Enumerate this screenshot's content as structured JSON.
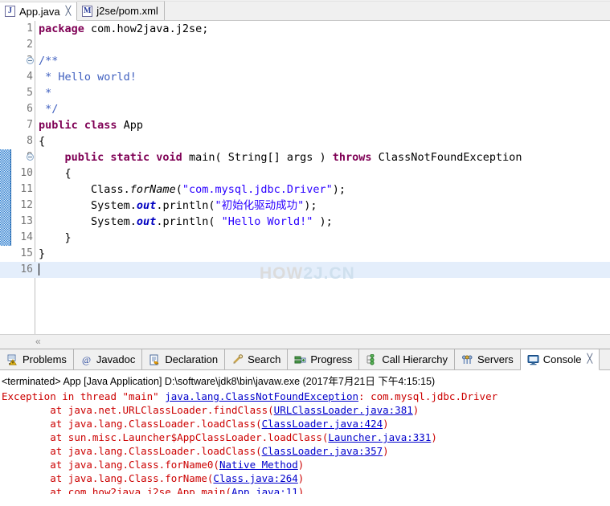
{
  "editor_tabs": [
    {
      "label": "App.java",
      "icon": "java-file-icon",
      "icon_letter": "J",
      "active": true,
      "closable": true
    },
    {
      "label": "j2se/pom.xml",
      "icon": "maven-file-icon",
      "icon_letter": "M",
      "active": false,
      "closable": false
    }
  ],
  "close_glyph": "╳",
  "editor": {
    "scroll_chevron": "«",
    "watermark_part1": "HOW",
    "watermark_part2": "2J.CN",
    "marker_start_line": 9,
    "marker_end_line": 14,
    "highlighted_line": 16,
    "lines": [
      {
        "n": "1",
        "fold": false,
        "segments": [
          {
            "t": "package ",
            "c": "kw"
          },
          {
            "t": "com.how2java.j2se;",
            "c": "plain"
          }
        ]
      },
      {
        "n": "2",
        "fold": false,
        "segments": []
      },
      {
        "n": "3",
        "fold": true,
        "segments": [
          {
            "t": "/**",
            "c": "cmt"
          }
        ]
      },
      {
        "n": "4",
        "fold": false,
        "segments": [
          {
            "t": " * Hello world!",
            "c": "cmt"
          }
        ]
      },
      {
        "n": "5",
        "fold": false,
        "segments": [
          {
            "t": " *",
            "c": "cmt"
          }
        ]
      },
      {
        "n": "6",
        "fold": false,
        "segments": [
          {
            "t": " */",
            "c": "cmt"
          }
        ]
      },
      {
        "n": "7",
        "fold": false,
        "segments": [
          {
            "t": "public class ",
            "c": "kw"
          },
          {
            "t": "App",
            "c": "plain"
          }
        ]
      },
      {
        "n": "8",
        "fold": false,
        "segments": [
          {
            "t": "{",
            "c": "plain"
          }
        ]
      },
      {
        "n": "9",
        "fold": true,
        "segments": [
          {
            "t": "    ",
            "c": "plain"
          },
          {
            "t": "public static void ",
            "c": "kw"
          },
          {
            "t": "main( String[] args ) ",
            "c": "plain"
          },
          {
            "t": "throws ",
            "c": "kw"
          },
          {
            "t": "ClassNotFoundException",
            "c": "plain"
          }
        ]
      },
      {
        "n": "10",
        "fold": false,
        "segments": [
          {
            "t": "    {",
            "c": "plain"
          }
        ]
      },
      {
        "n": "11",
        "fold": false,
        "segments": [
          {
            "t": "        Class.",
            "c": "plain"
          },
          {
            "t": "forName",
            "c": "stat"
          },
          {
            "t": "(",
            "c": "plain"
          },
          {
            "t": "\"com.mysql.jdbc.Driver\"",
            "c": "str"
          },
          {
            "t": ");",
            "c": "plain"
          }
        ]
      },
      {
        "n": "12",
        "fold": false,
        "segments": [
          {
            "t": "        System.",
            "c": "plain"
          },
          {
            "t": "out",
            "c": "fld"
          },
          {
            "t": ".println(",
            "c": "plain"
          },
          {
            "t": "\"初始化驱动成功\"",
            "c": "str"
          },
          {
            "t": ");",
            "c": "plain"
          }
        ]
      },
      {
        "n": "13",
        "fold": false,
        "segments": [
          {
            "t": "        System.",
            "c": "plain"
          },
          {
            "t": "out",
            "c": "fld"
          },
          {
            "t": ".println( ",
            "c": "plain"
          },
          {
            "t": "\"Hello World!\"",
            "c": "str"
          },
          {
            "t": " );",
            "c": "plain"
          }
        ]
      },
      {
        "n": "14",
        "fold": false,
        "segments": [
          {
            "t": "    }",
            "c": "plain"
          }
        ]
      },
      {
        "n": "15",
        "fold": false,
        "segments": [
          {
            "t": "}",
            "c": "plain"
          }
        ]
      },
      {
        "n": "16",
        "fold": false,
        "caret": true,
        "segments": []
      }
    ]
  },
  "view_tabs": [
    {
      "label": "Problems",
      "icon": "problems-icon",
      "active": false,
      "closable": false
    },
    {
      "label": "Javadoc",
      "icon": "javadoc-icon",
      "active": false,
      "closable": false
    },
    {
      "label": "Declaration",
      "icon": "declaration-icon",
      "active": false,
      "closable": false
    },
    {
      "label": "Search",
      "icon": "search-icon",
      "active": false,
      "closable": false
    },
    {
      "label": "Progress",
      "icon": "progress-icon",
      "active": false,
      "closable": false
    },
    {
      "label": "Call Hierarchy",
      "icon": "call-hierarchy-icon",
      "active": false,
      "closable": false
    },
    {
      "label": "Servers",
      "icon": "servers-icon",
      "active": false,
      "closable": false
    },
    {
      "label": "Console",
      "icon": "console-icon",
      "active": true,
      "closable": true
    }
  ],
  "console": {
    "header": "<terminated> App [Java Application] D:\\software\\jdk8\\bin\\javaw.exe (2017年7月21日 下午4:15:15)",
    "lines": [
      {
        "parts": [
          {
            "t": "Exception in thread ",
            "link": false
          },
          {
            "t": "\"main\" ",
            "link": false
          },
          {
            "t": "java.lang.ClassNotFoundException",
            "link": true
          },
          {
            "t": ": com.mysql.jdbc.Driver",
            "link": false
          }
        ]
      },
      {
        "parts": [
          {
            "t": "\tat java.net.URLClassLoader.findClass(",
            "link": false
          },
          {
            "t": "URLClassLoader.java:381",
            "link": true
          },
          {
            "t": ")",
            "link": false
          }
        ]
      },
      {
        "parts": [
          {
            "t": "\tat java.lang.ClassLoader.loadClass(",
            "link": false
          },
          {
            "t": "ClassLoader.java:424",
            "link": true
          },
          {
            "t": ")",
            "link": false
          }
        ]
      },
      {
        "parts": [
          {
            "t": "\tat sun.misc.Launcher$AppClassLoader.loadClass(",
            "link": false
          },
          {
            "t": "Launcher.java:331",
            "link": true
          },
          {
            "t": ")",
            "link": false
          }
        ]
      },
      {
        "parts": [
          {
            "t": "\tat java.lang.ClassLoader.loadClass(",
            "link": false
          },
          {
            "t": "ClassLoader.java:357",
            "link": true
          },
          {
            "t": ")",
            "link": false
          }
        ]
      },
      {
        "parts": [
          {
            "t": "\tat java.lang.Class.forName0(",
            "link": false
          },
          {
            "t": "Native Method",
            "link": true
          },
          {
            "t": ")",
            "link": false
          }
        ]
      },
      {
        "parts": [
          {
            "t": "\tat java.lang.Class.forName(",
            "link": false
          },
          {
            "t": "Class.java:264",
            "link": true
          },
          {
            "t": ")",
            "link": false
          }
        ]
      },
      {
        "parts": [
          {
            "t": "\tat com.how2java.j2se.App.main(",
            "link": false
          },
          {
            "t": "App.java:11",
            "link": true
          },
          {
            "t": ")",
            "link": false
          }
        ]
      }
    ]
  },
  "colors": {
    "error_red": "#cc0000",
    "link_blue": "#0000cc",
    "keyword_purple": "#7f0055",
    "string_blue": "#2a00ff",
    "comment_blue": "#3f5fbf",
    "marker_blue": "#2f7fd0",
    "highlight_line": "#e4eefb"
  }
}
